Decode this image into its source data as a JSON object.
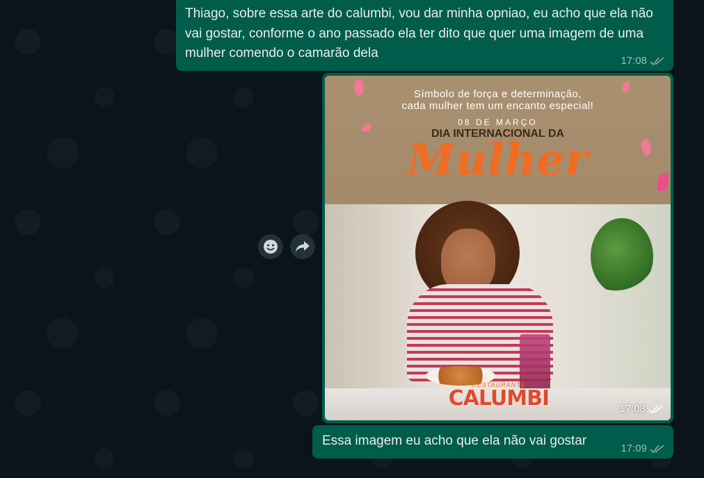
{
  "messages": [
    {
      "text": "Thiago, sobre essa arte do calumbi, vou dar minha opniao, eu acho que ela não vai gostar, conforme o ano passado ela ter dito que quer uma imagem de uma mulher comendo o camarão dela",
      "time": "17:08",
      "status": "read-ticks"
    },
    {
      "type": "image",
      "time": "17:08",
      "status": "read-ticks",
      "poster": {
        "line1": "Símbolo de força e determinação,",
        "line2": "cada mulher tem um encanto especial!",
        "date": "08 DE MARÇO",
        "heading": "DIA INTERNACIONAL DA",
        "script": "Mulher",
        "logo_sub": "RESTAURANTE",
        "logo_main": "CALUMBI"
      }
    },
    {
      "text": "Essa imagem eu acho que ela não vai gostar",
      "time": "17:09",
      "status": "read-ticks"
    }
  ],
  "hover_actions": [
    {
      "icon": "emoji-icon"
    },
    {
      "icon": "forward-icon"
    }
  ],
  "colors": {
    "background": "#0b141a",
    "outgoing_bubble": "#005c4b",
    "text": "#e9edef",
    "accent_orange": "#f26b22"
  }
}
